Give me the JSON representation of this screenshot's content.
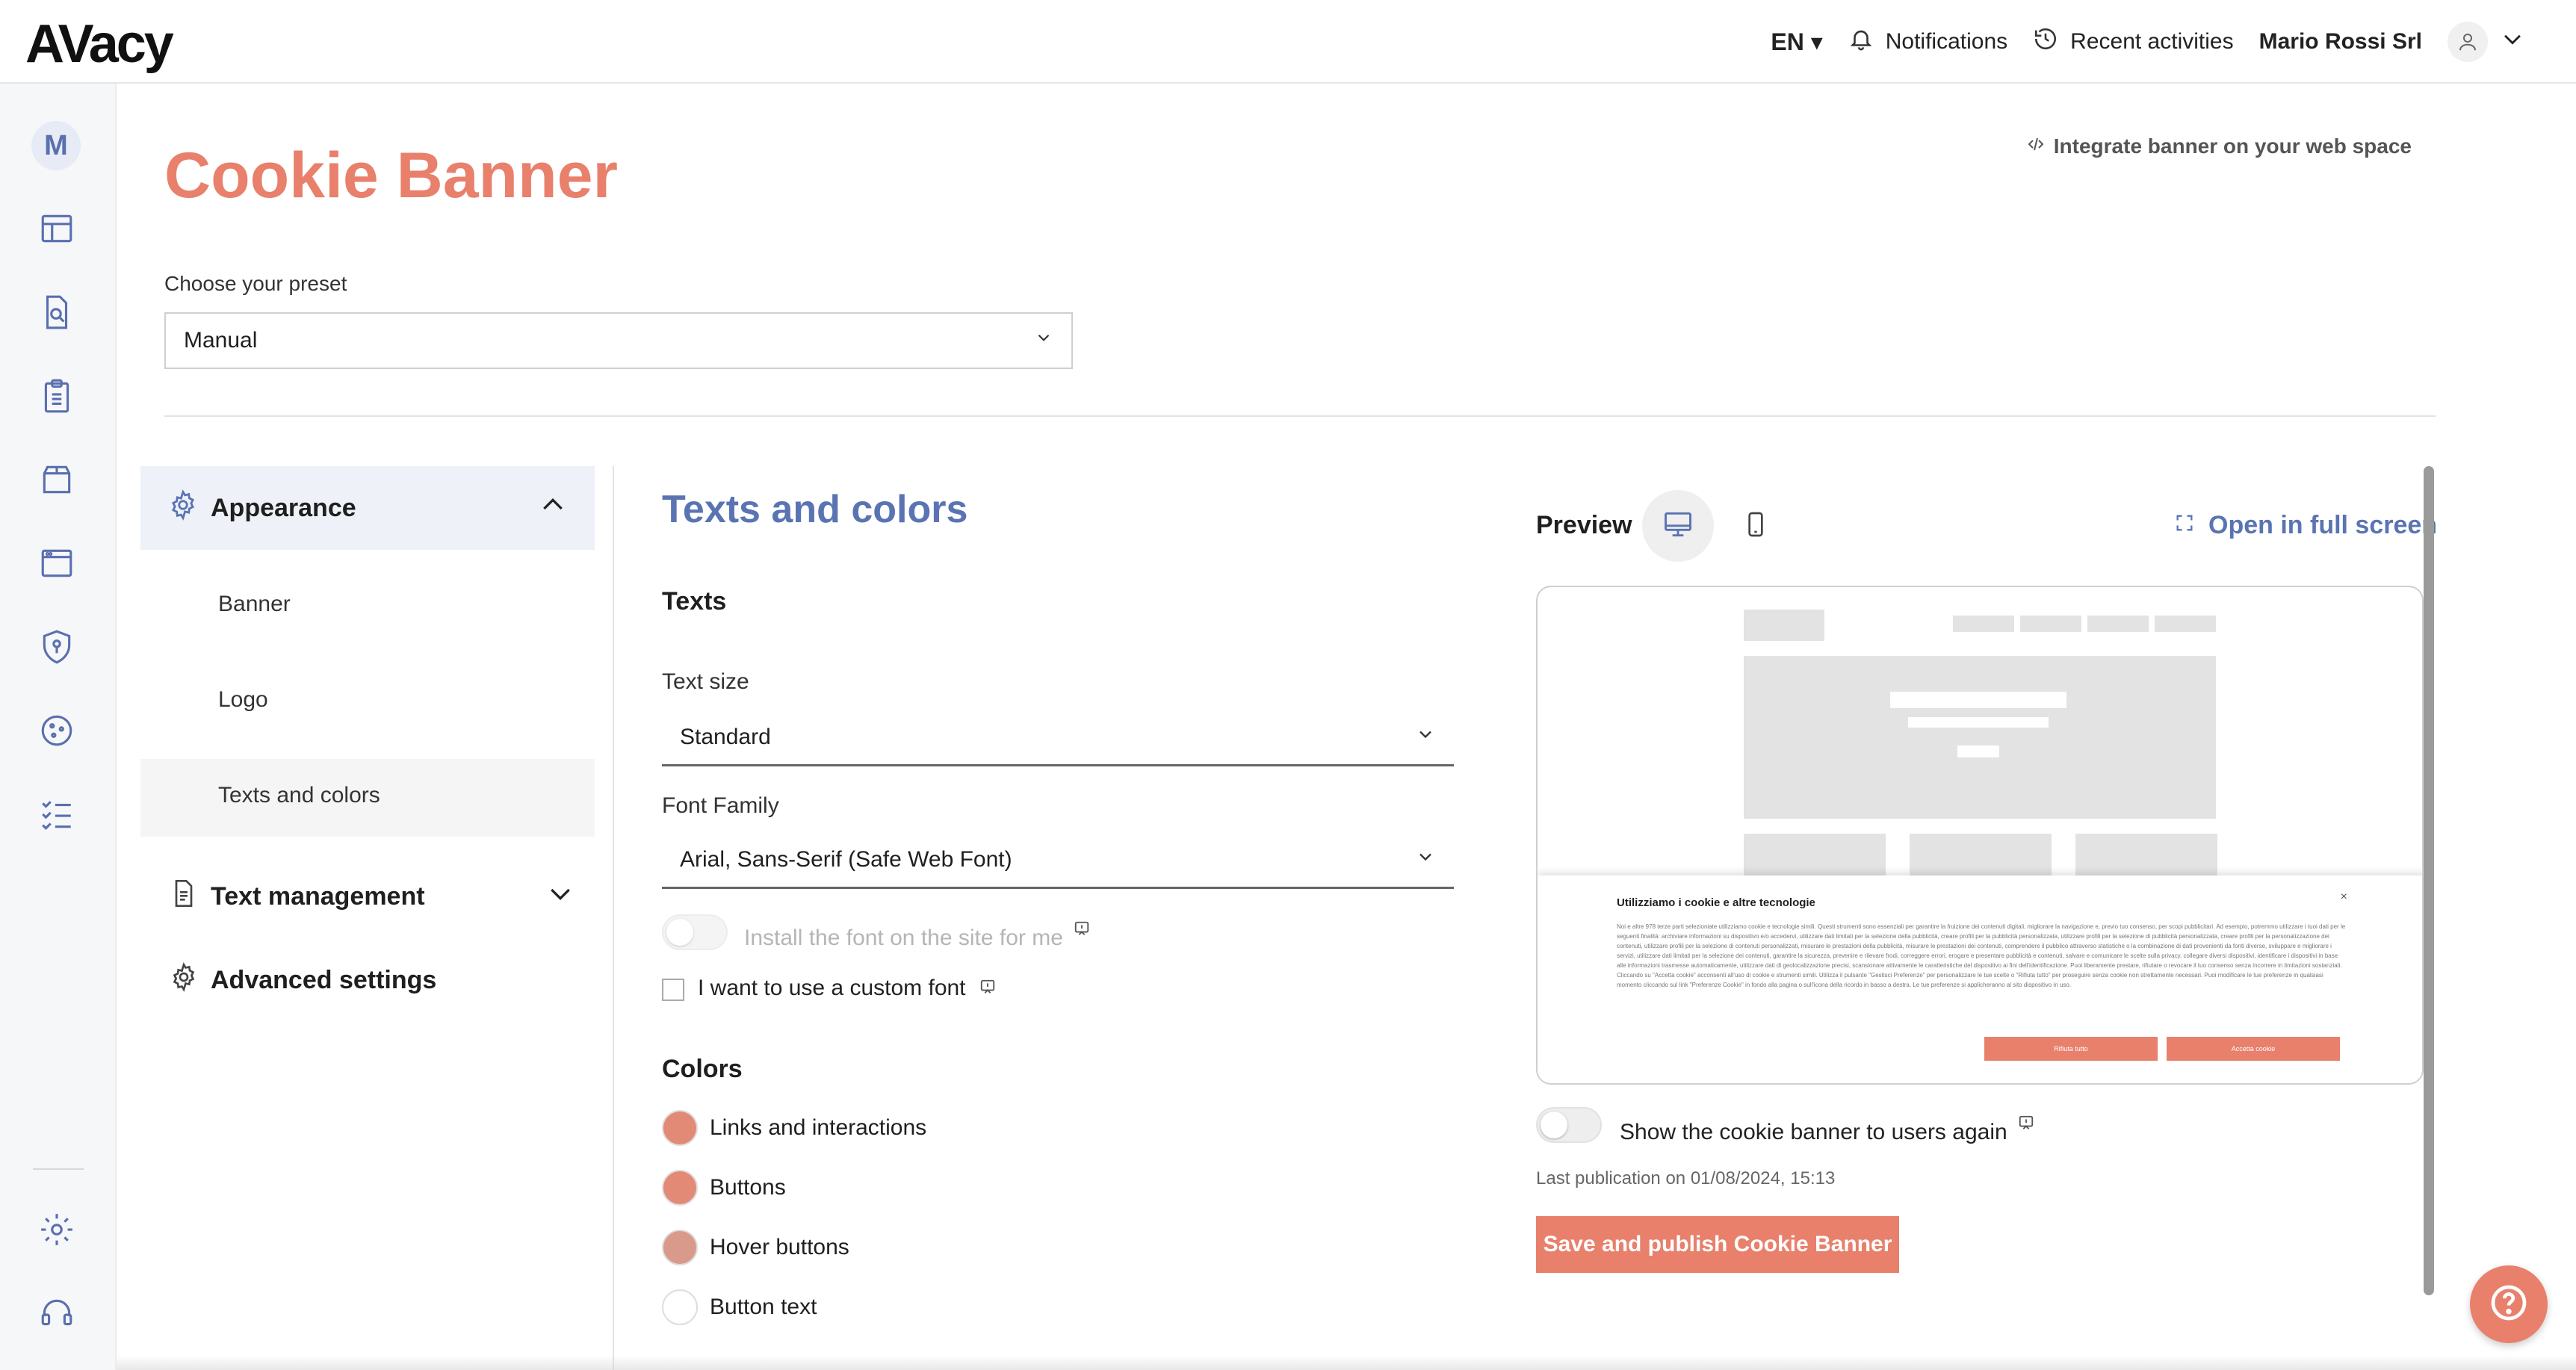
{
  "app": {
    "logo": "AVacy"
  },
  "topnav": {
    "lang": "EN ▾",
    "notifications": "Notifications",
    "recent": "Recent activities",
    "user": "Mario Rossi Srl"
  },
  "rail": {
    "avatar_letter": "M"
  },
  "page": {
    "title": "Cookie Banner",
    "integrate": "Integrate banner on your web space",
    "preset_label": "Choose your preset",
    "preset_value": "Manual"
  },
  "menu": {
    "appearance": "Appearance",
    "sub": [
      "Banner",
      "Logo",
      "Texts and colors"
    ],
    "text_management": "Text management",
    "advanced": "Advanced settings"
  },
  "texts_colors": {
    "title": "Texts and colors",
    "texts_heading": "Texts",
    "text_size_label": "Text size",
    "text_size_value": "Standard",
    "font_family_label": "Font Family",
    "font_family_value": "Arial, Sans-Serif (Safe Web Font)",
    "install_font": "Install the font on the site for me",
    "custom_font": "I want to use a custom font",
    "colors_heading": "Colors",
    "colors": [
      {
        "label": "Links and interactions",
        "color": "#e38a76"
      },
      {
        "label": "Buttons",
        "color": "#e38a76"
      },
      {
        "label": "Hover buttons",
        "color": "#d99a8c"
      },
      {
        "label": "Button text",
        "color": "#ffffff"
      }
    ]
  },
  "preview": {
    "label": "Preview",
    "fullscreen": "Open in full screen",
    "banner_title": "Utilizziamo i cookie e altre tecnologie",
    "banner_close": "×",
    "banner_text": "Noi e altre 978 terze parti selezioniate utilizziamo cookie e tecnologie simili. Questi strumenti sono essenziali per garantire la fruizione dei contenuti digitali, migliorare la navigazione e, previo tuo consenso, per scopi pubblicitari. Ad esempio, potremmo utilizzare i tuoi dati per le seguenti finalità: archiviare informazioni su dispositivo e/o accedervi, utilizzare dati limitati per la selezione della pubblicità, creare profili per la pubblicità personalizzata, utilizzare profili per la selezione di pubblicità personalizzata, creare profili per la personalizzazione dei contenuti, utilizzare profili per la selezione di contenuti personalizzati, misurare le prestazioni della pubblicità, misurare le prestazioni dei contenuti, comprendere il pubblico attraverso statistiche o la combinazione di dati provenienti da fonti diverse, sviluppare e migliorare i servizi, utilizzare dati limitati per la selezione dei contenuti, garantire la sicurezza, prevenire e rilevare frodi, correggere errori, erogare e presentare pubblicità e contenuti, salvare e comunicare le scelte sulla privacy, collegare diversi dispositivi, identificare i dispositivi in base alle informazioni trasmesse automaticamente, utilizzare dati di geolocalizzazione precisi, scansionare attivamente le caratteristiche del dispositivo ai fini dell'identificazione. Puoi liberamente prestare, rifiutare o revocare il tuo consenso senza incorrere in limitazioni sostanziali. Cliccando su \"Accetta cookie\" acconsenti all'uso di cookie e strumenti simili. Utilizza il pulsante \"Gestisci Preferenze\" per personalizzare le tue scelte o \"Rifiuta tutto\" per proseguire senza cookie non strettamente necessari. Puoi modificare le tue preferenze in qualsiasi momento cliccando sul link \"Preferenze Cookie\" in fondo alla pagina o sull'icona della ricordo in basso a destra. Le tue preferenze si applicheranno al sito dispositivo in uso.",
    "reject_button": "Rifiuta tutto",
    "accept_button": "Accetta cookie",
    "show_again": "Show the cookie banner to users again",
    "last_publication": "Last publication on 01/08/2024, 15:13",
    "save_button": "Save and publish Cookie Banner"
  },
  "accent": "#e8806c",
  "link_color": "#5a74b3"
}
